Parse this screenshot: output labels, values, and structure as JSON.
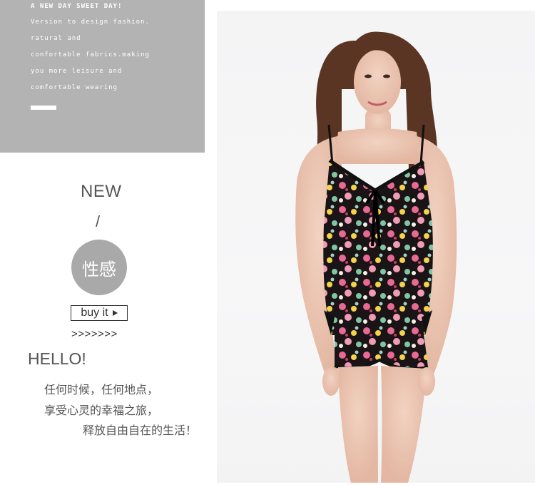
{
  "banner": {
    "lines": [
      "A NEW DAY SWEET DAY!",
      "Version to design fashion.",
      "ratural and",
      "confortable fabrics.making",
      "you more leisure and",
      "comfortable wearing"
    ]
  },
  "promo": {
    "new_label": "NEW",
    "slash": "/",
    "circle_label": "性感",
    "buy_label": "buy it",
    "arrows": ">>>>>>>"
  },
  "hello": {
    "title": "HELLO!",
    "line1": "任何时候，任何地点，",
    "line2": "享受心灵的幸福之旅，",
    "line3": "释放自由自在的生活！"
  },
  "colors": {
    "panel_gray": "#b3b3b3",
    "circle_gray": "#a9a9a9",
    "text_gray": "#555555"
  }
}
